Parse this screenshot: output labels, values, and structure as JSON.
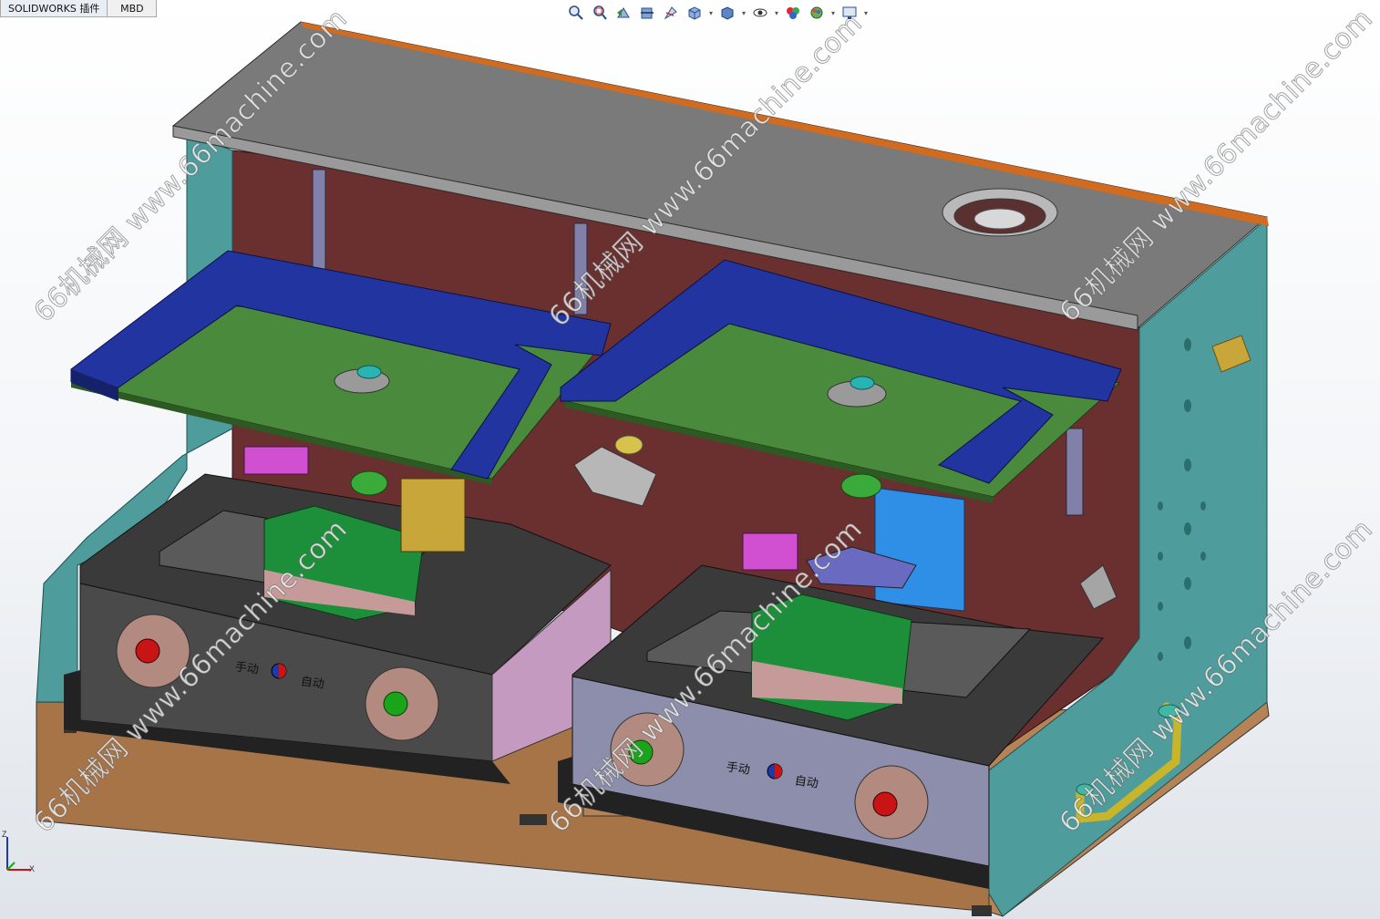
{
  "tabs": [
    {
      "label": "SOLIDWORKS 插件"
    },
    {
      "label": "MBD"
    }
  ],
  "view_toolbar": {
    "icons": [
      "zoom-to-fit-icon",
      "zoom-to-area-icon",
      "previous-view-icon",
      "section-view-icon",
      "dynamic-annotation-icon",
      "view-orientation-icon",
      "display-style-icon",
      "hide-show-items-icon",
      "edit-appearance-icon",
      "apply-scene-icon",
      "view-settings-icon"
    ]
  },
  "panel_left": {
    "manual_label": "手动",
    "auto_label": "自动"
  },
  "panel_right": {
    "manual_label": "手动",
    "auto_label": "自动"
  },
  "watermark_text": "66机械网 www.66machine.com",
  "triad": {
    "y_label": "Z",
    "x_label": "X"
  },
  "colors": {
    "frame_teal": "#4f9a9a",
    "back_panel": "#6b3030",
    "top_plate": "#7b7b7b",
    "blue_frame": "#2438a6",
    "green_plate": "#4f8a3a",
    "base_wood": "#b07a4b"
  }
}
